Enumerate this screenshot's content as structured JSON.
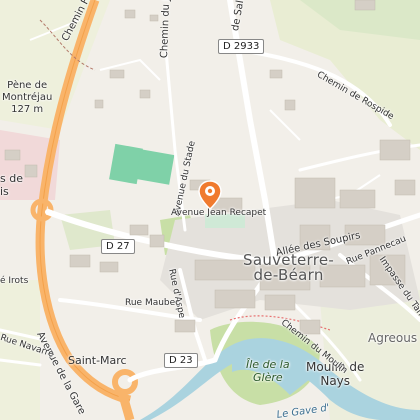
{
  "map": {
    "place_labels": {
      "sauveterre": "Sauveterre-\nde-Béarn",
      "moulin_de_nays": "Moulin de\nNays",
      "saint_marc": "Saint-Marc",
      "agreous": "Agreous",
      "pene": "Pène de\nMontréjau\n127 m",
      "ile_glere": "Île de la\nGlère",
      "left_de": "s de\nis"
    },
    "road_labels": {
      "chemin_febus": "Chemin Fébus",
      "chemin_du_ju": "Chemin du Ju",
      "de_salies": "de Salies",
      "chemin_rospide": "Chemin de Rospide",
      "avenue_du_stade": "Avenue du Stade",
      "avenue_jean_recapet": "Avenue Jean Recapet",
      "allee_des_soupirs": "Allée des Soupirs",
      "rue_pannecau": "Rue Pannecau",
      "impasse_tan": "Impasse du Tan",
      "rue_d_aspe": "Rue d'Aspe",
      "rue_maubec": "Rue Maubec",
      "chemin_du_moulin": "Chemin du Moulin",
      "avenue_gare": "Avenue de la Gare",
      "rue_navarre": "Rue Navarre",
      "irots": "é Irots",
      "gave": "Le Gave d'"
    },
    "road_badges": {
      "d2933": "D 2933",
      "d27": "D 27",
      "d23": "D 23"
    },
    "marker": {
      "icon": "map-pin-icon",
      "color": "#f07a2e"
    },
    "colors": {
      "background": "#f2efe9",
      "major_road": "#f9b46a",
      "water": "#aad3df",
      "sports_field": "#7fd1a8",
      "wood": "#c8dfa6"
    }
  }
}
